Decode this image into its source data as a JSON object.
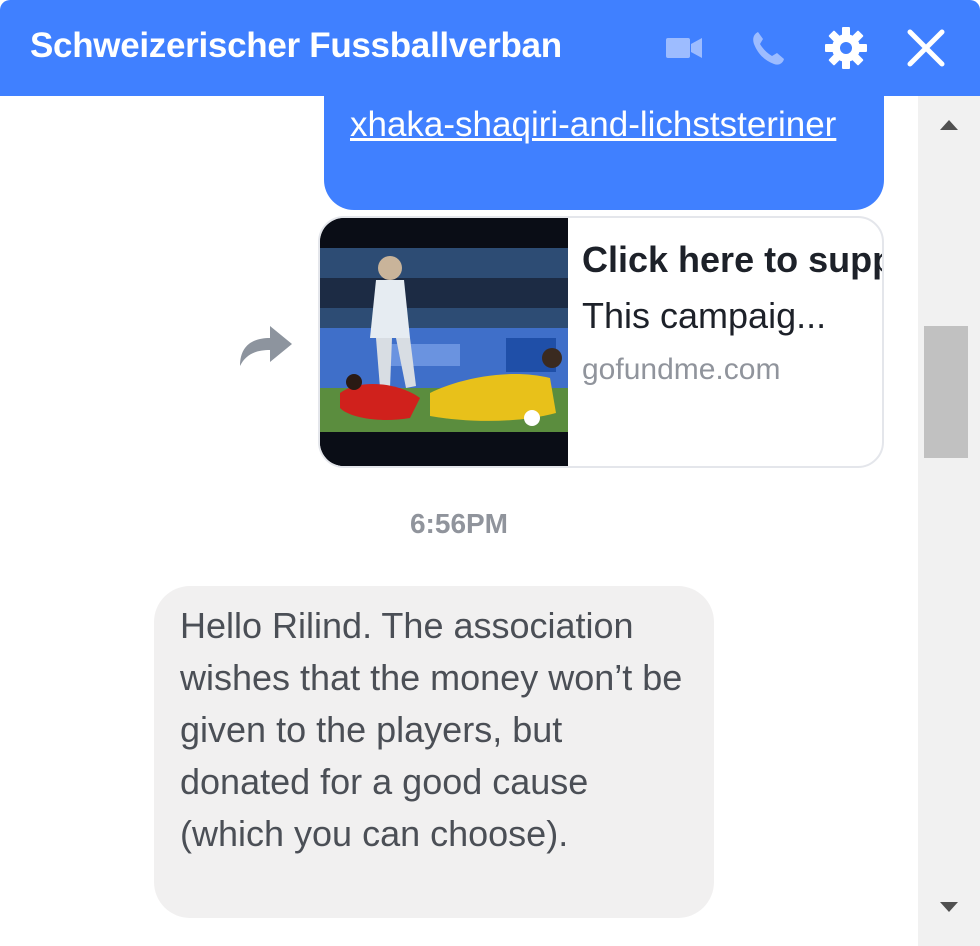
{
  "header": {
    "title": "Schweizerischer Fussballverban",
    "color": "#4080ff",
    "icons": [
      "video-camera-icon",
      "phone-icon",
      "gear-icon",
      "close-icon"
    ]
  },
  "messages": {
    "sent_link_text": "xhaka-shaqiri-and-lichststeriner",
    "link_card": {
      "title": "Click here to support Xhaka,",
      "description": "This campaig...",
      "domain": "gofundme.com"
    },
    "timestamp": "6:56PM",
    "received_text": "Hello Rilind. The association wishes that the money won’t be given to the players, but donated for a good cause (which you can choose)."
  },
  "colors": {
    "sent_bubble": "#4080ff",
    "received_bubble": "#f1f0f0",
    "timestamp": "#90949c"
  }
}
